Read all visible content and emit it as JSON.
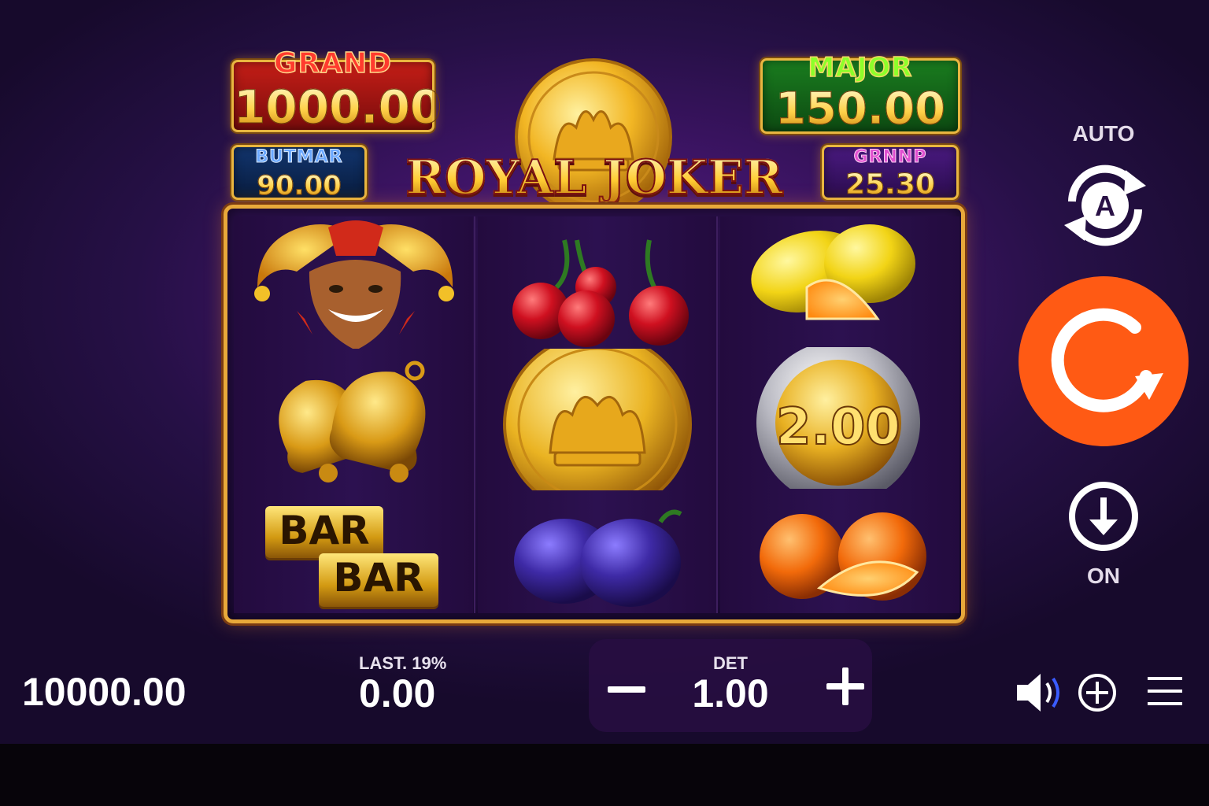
{
  "jackpots": {
    "grand": {
      "label": "GRAND",
      "value": "1000.00"
    },
    "major": {
      "label": "MAJOR",
      "value": "150.00"
    },
    "minor": {
      "label": "BUTMAR",
      "value": "90.00"
    },
    "mini": {
      "label": "GRNNP",
      "value": "25.30"
    }
  },
  "game": {
    "title": "ROYAL JOKER"
  },
  "reels": [
    {
      "symbols": [
        "joker",
        "bells",
        "bar-bar"
      ],
      "bar_text": [
        "BAR",
        "BAR"
      ]
    },
    {
      "symbols": [
        "cherries",
        "crown-coin",
        "plums"
      ]
    },
    {
      "symbols": [
        "lemons",
        "bonus-coin",
        "oranges"
      ],
      "bonus_value": "2.00"
    }
  ],
  "controls": {
    "auto_label": "AUTO",
    "auto_icon": "autoplay-icon",
    "spin_icon": "spin-icon",
    "turbo_icon": "arrow-down-icon",
    "turbo_label": "ON",
    "spin_color": "#ff5a14"
  },
  "footer": {
    "balance": "10000.00",
    "last_win_label": "LAST. 19%",
    "last_win_value": "0.00",
    "bet_label": "DET",
    "bet_value": "1.00",
    "icons": [
      "sound-icon",
      "info-icon",
      "menu-icon"
    ]
  }
}
